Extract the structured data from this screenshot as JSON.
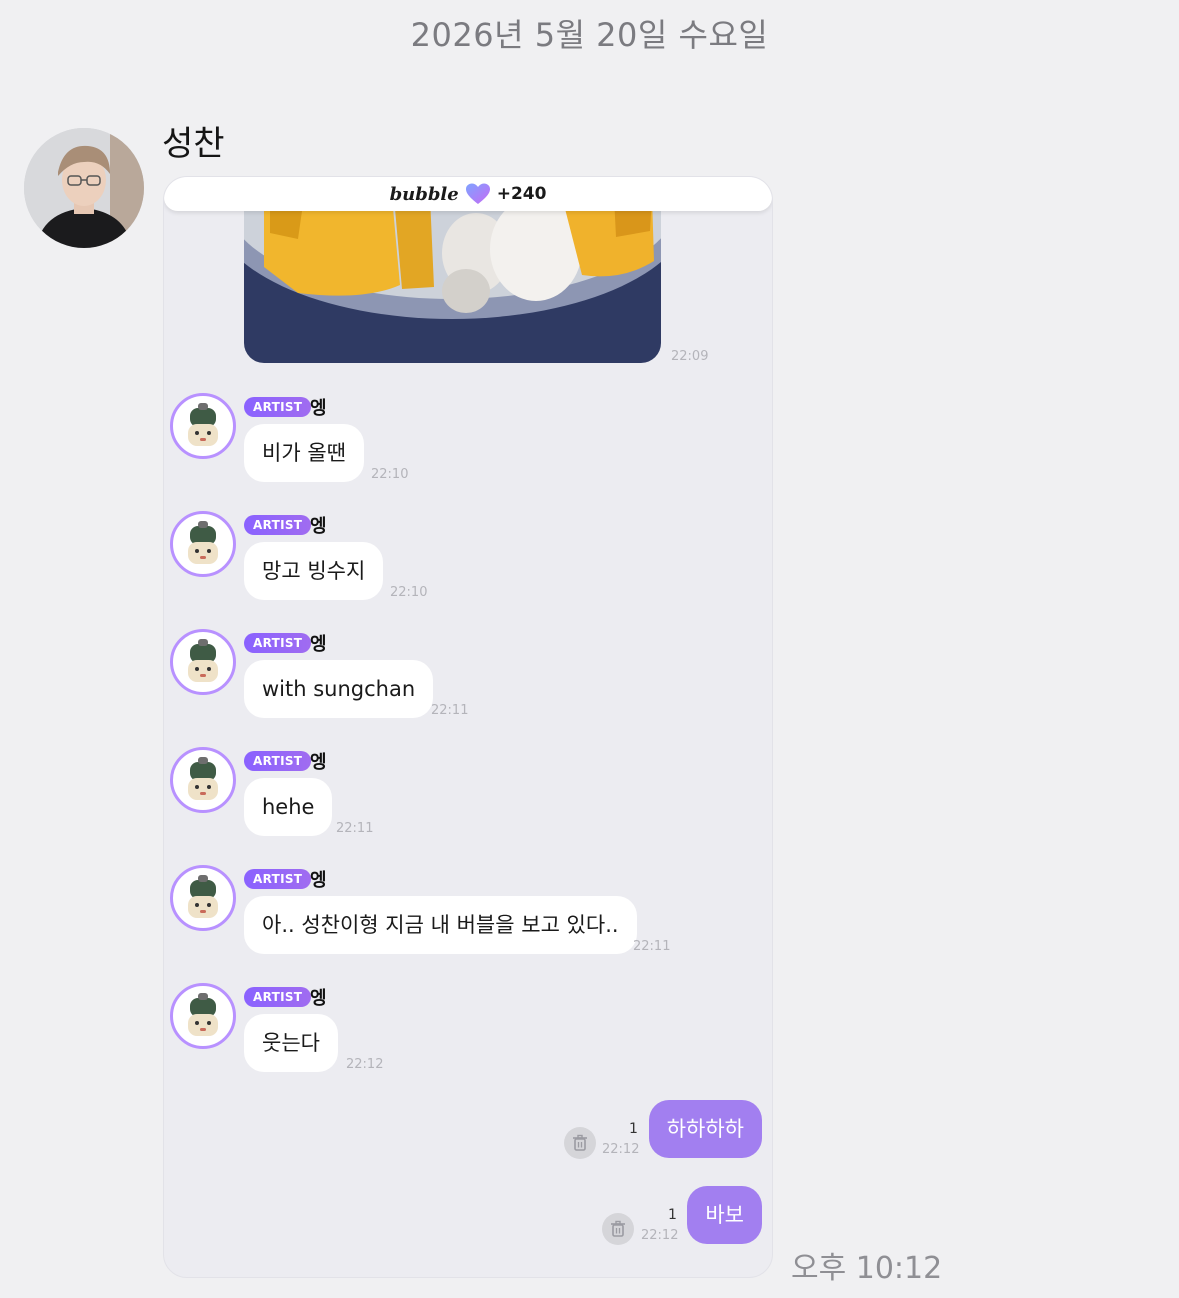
{
  "date_header": "2026년 5월 20일 수요일",
  "sender": {
    "name": "성찬"
  },
  "card": {
    "brand": "bubble",
    "points": "+240",
    "photo_time": "22:09",
    "messages": [
      {
        "badge": "ARTIST",
        "name": "엥",
        "text": "비가 올땐",
        "time": "22:10"
      },
      {
        "badge": "ARTIST",
        "name": "엥",
        "text": "망고 빙수지",
        "time": "22:10"
      },
      {
        "badge": "ARTIST",
        "name": "엥",
        "text": "with sungchan",
        "time": "22:11"
      },
      {
        "badge": "ARTIST",
        "name": "엥",
        "text": "hehe",
        "time": "22:11"
      },
      {
        "badge": "ARTIST",
        "name": "엥",
        "text": "아.. 성찬이형 지금 내 버블을 보고 있다..",
        "time": "22:11"
      },
      {
        "badge": "ARTIST",
        "name": "엥",
        "text": "웃는다",
        "time": "22:12"
      }
    ],
    "replies": [
      {
        "text": "하하하하",
        "unread": "1",
        "time": "22:12"
      },
      {
        "text": "바보",
        "unread": "1",
        "time": "22:12"
      }
    ]
  },
  "footer_time": "오후 10:12",
  "colors": {
    "background": "#f0f0f2",
    "card_background": "#ececf1",
    "accent_purple": "#a27ff0",
    "badge_purple": "#8a62ff",
    "timestamp_gray": "#b4b4ba"
  },
  "icons": [
    "bubble-heart-icon",
    "trash-icon"
  ]
}
